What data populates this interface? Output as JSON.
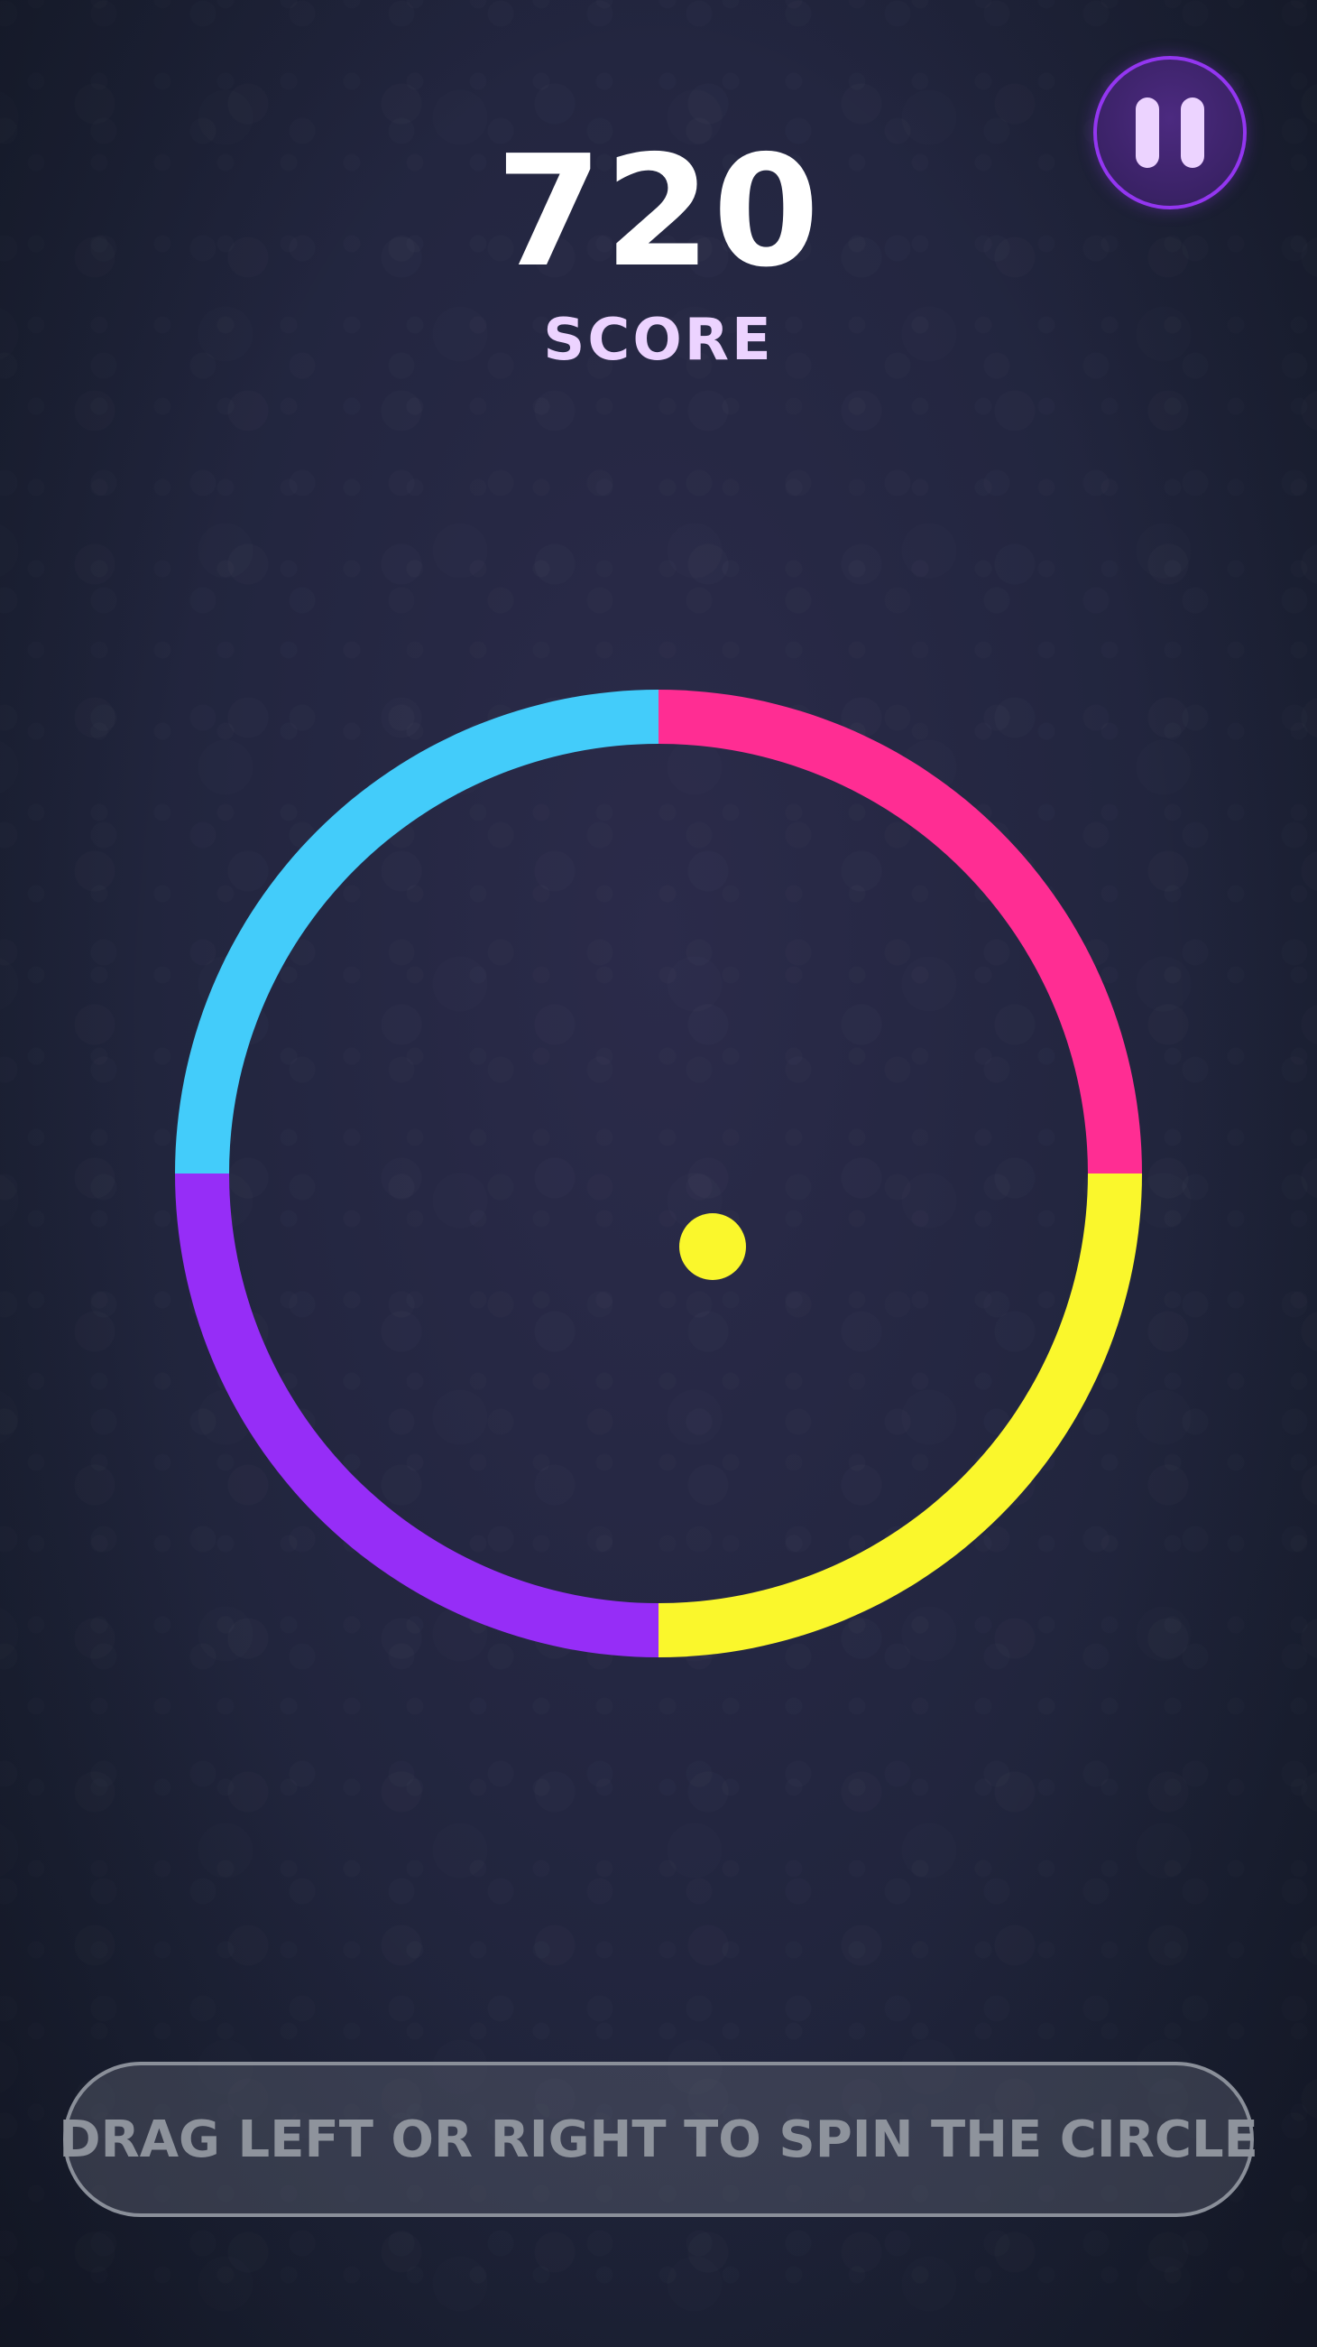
{
  "score": {
    "value": "720",
    "label": "SCORE"
  },
  "pause_button": {
    "icon": "pause-icon"
  },
  "ring": {
    "segments": [
      {
        "name": "top-right",
        "color": "#ff2d93"
      },
      {
        "name": "bottom-right",
        "color": "#faf72c"
      },
      {
        "name": "bottom-left",
        "color": "#962df7"
      },
      {
        "name": "top-left",
        "color": "#43ccfa"
      }
    ]
  },
  "ball": {
    "color": "#faf72c"
  },
  "hint": {
    "text": "DRAG LEFT OR RIGHT TO SPIN THE CIRCLE"
  },
  "colors": {
    "background": "#232640",
    "score_text": "#ffffff",
    "score_label": "#ecd3ff",
    "pause_border": "#9336f0"
  }
}
